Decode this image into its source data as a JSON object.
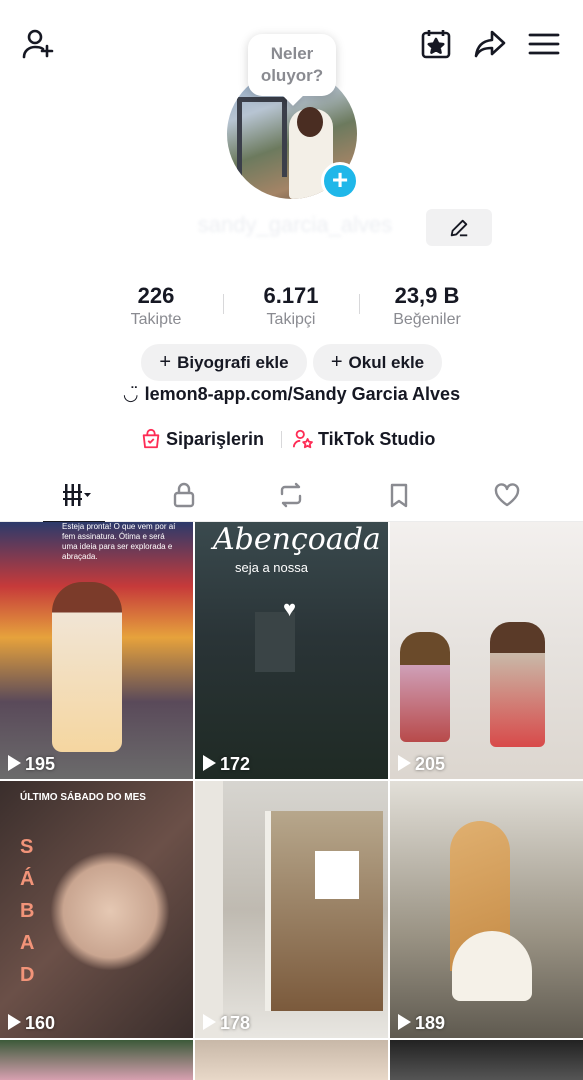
{
  "header": {
    "add_friend_icon": "person-plus-icon",
    "calendar_icon": "calendar-star-icon",
    "share_icon": "share-arrow-icon",
    "menu_icon": "hamburger-menu-icon"
  },
  "status_bubble": {
    "line1": "Neler",
    "line2": "oluyor?"
  },
  "profile": {
    "username": "sandy_garcia_alves",
    "add_photo_badge": "+"
  },
  "stats": [
    {
      "value": "226",
      "label": "Takipte"
    },
    {
      "value": "6.171",
      "label": "Takipçi"
    },
    {
      "value": "23,9 B",
      "label": "Beğeniler"
    }
  ],
  "actions": {
    "bio_button": "Biyografi ekle",
    "school_button": "Okul ekle",
    "plus": "+"
  },
  "bio_link": {
    "icon": "◡̈",
    "text": "lemon8-app.com/Sandy Garcia Alves"
  },
  "shortcuts": {
    "orders": "Siparişlerin",
    "studio": "TikTok Studio"
  },
  "tabs": [
    {
      "name": "videos",
      "icon": "grid-bars-icon"
    },
    {
      "name": "private",
      "icon": "lock-icon"
    },
    {
      "name": "reposts",
      "icon": "repost-icon"
    },
    {
      "name": "favorites",
      "icon": "bookmark-icon"
    },
    {
      "name": "liked",
      "icon": "heart-outline-icon"
    }
  ],
  "videos": [
    {
      "views": "195",
      "overlay": "Esteja pronta! O que vem por aí fem assinatura. Ótima e será uma ideia para ser explorada e abraçada."
    },
    {
      "views": "172",
      "title": "Abençoada",
      "subtitle": "seja a nossa"
    },
    {
      "views": "205"
    },
    {
      "views": "160",
      "title": "ÚLTIMO SÁBADO DO MES",
      "vertical": "SÁBAD"
    },
    {
      "views": "178"
    },
    {
      "views": "189"
    }
  ],
  "colors": {
    "accent_pink": "#fe2c55",
    "badge_blue": "#1fb7e9",
    "text_primary": "#161823",
    "text_secondary": "#8a8b91"
  }
}
